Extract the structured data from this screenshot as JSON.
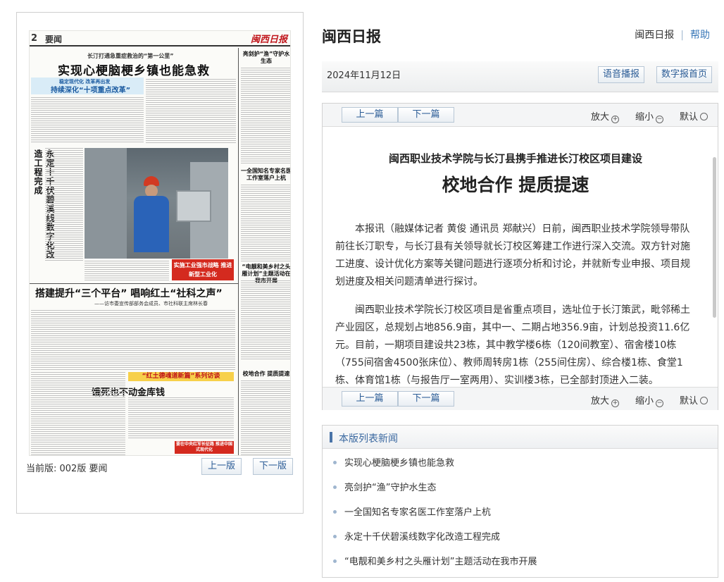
{
  "paper": {
    "page_no": "2",
    "section": "要闻",
    "masthead": "闽西日报",
    "kicker_top": "长汀打通急重症救治的“第一公里”",
    "headline_main": "实现心梗脑梗乡镇也能急救",
    "banner_line1": "稳定现代化  改革再出发",
    "banner_line2": "持续深化“十项重点改革”",
    "vertical_headline": "永定十千伏碧溪线数字化改造工程完成",
    "right_col_head": "亮剑护“渔”守护水生态",
    "right_col_head2": "一全国知名专家名医工作室落户上杭",
    "red_box_text": "实施工业强市战略 推进新型工业化",
    "headline_second": "搭建提升“三个平台” 唱响红土“社科之声”",
    "subhead_second": "——访市委宣传部部务会成员、市社科联主席林长春",
    "right_col_head3": "“电靓和美乡村之头雁计划”主题活动在我市开展",
    "yellow_bar": "“红土德魂道新篇”系列访谈",
    "headline_third": "饿死也不动金库钱",
    "right_col_head4": "校地合作 提质提速",
    "red_box2": "要在中央红军长征路 推进中国式现代化"
  },
  "left_footer": {
    "current_page": "当前版: 002版 要闻",
    "prev_page": "上一版",
    "next_page": "下一版"
  },
  "header": {
    "site_title": "闽西日报",
    "link_paper": "闽西日报",
    "link_help": "帮助"
  },
  "date_bar": {
    "date": "2024年11月12日",
    "voice_btn": "语音播报",
    "home_btn": "数字报首页"
  },
  "article_nav": {
    "prev": "上一篇",
    "next": "下一篇",
    "zoom_in": "放大",
    "zoom_out": "缩小",
    "zoom_default": "默认"
  },
  "article": {
    "subtitle": "闽西职业技术学院与长汀县携手推进长汀校区项目建设",
    "title": "校地合作 提质提速",
    "paragraphs": [
      "本报讯（融媒体记者 黄俊 通讯员 郑献兴）日前，闽西职业技术学院领导带队前往长汀职专，与长汀县有关领导就长汀校区筹建工作进行深入交流。双方针对施工进度、设计优化方案等关键问题进行逐项分析和讨论，并就新专业申报、项目规划进度及相关问题清单进行探讨。",
      "闽西职业技术学院长汀校区项目是省重点项目，选址位于长汀策武，毗邻稀土产业园区，总规划占地856.9亩，其中一、二期占地356.9亩，计划总投资11.6亿元。目前，一期项目建设共23栋，其中教学楼6栋（120间教室）、宿舍楼10栋（755间宿舍4500张床位）、教师周转房1栋（255间住房）、综合楼1栋、食堂1栋、体育馆1栋（与报告厅一室两用）、实训楼3栋，已全部封顶进入二装。"
    ]
  },
  "news_list": {
    "heading": "本版列表新闻",
    "items": [
      "实现心梗脑梗乡镇也能急救",
      "亮剑护“渔”守护水生态",
      "一全国知名专家名医工作室落户上杭",
      "永定十千伏碧溪线数字化改造工程完成",
      "“电靓和美乡村之头雁计划”主题活动在我市开展"
    ]
  }
}
